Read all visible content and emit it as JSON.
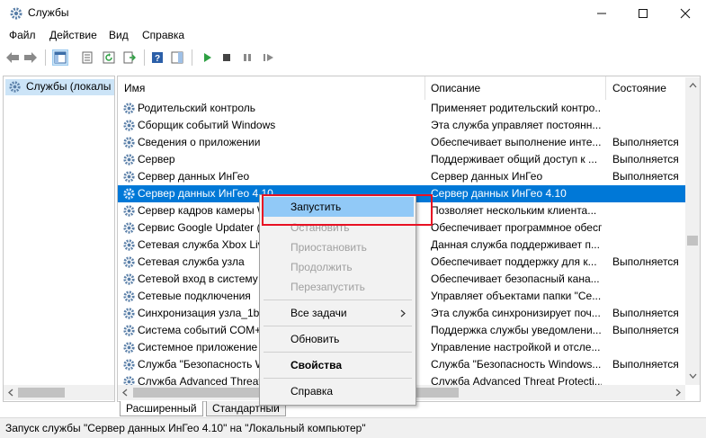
{
  "window": {
    "title": "Службы"
  },
  "menu": [
    "Файл",
    "Действие",
    "Вид",
    "Справка"
  ],
  "tree": {
    "root_label": "Службы (локалы"
  },
  "columns": {
    "name": "Имя",
    "description": "Описание",
    "status": "Состояние"
  },
  "rows": [
    {
      "name": "Родительский контроль",
      "desc": "Применяет родительский контро...",
      "status": ""
    },
    {
      "name": "Сборщик событий Windows",
      "desc": "Эта служба управляет постоянн...",
      "status": ""
    },
    {
      "name": "Сведения о приложении",
      "desc": "Обеспечивает выполнение инте...",
      "status": "Выполняется"
    },
    {
      "name": "Сервер",
      "desc": "Поддерживает общий доступ к ...",
      "status": "Выполняется"
    },
    {
      "name": "Сервер данных ИнГео",
      "desc": "Сервер данных ИнГео",
      "status": "Выполняется"
    },
    {
      "name": "Сервер данных ИнГео 4.10",
      "desc": "Сервер данных ИнГео 4.10",
      "status": ""
    },
    {
      "name": "Сервер кадров камеры W",
      "desc": "Позволяет нескольким клиента...",
      "status": ""
    },
    {
      "name": "Сервис Google Updater (",
      "desc": "Обеспечивает программное обесп...",
      "status": ""
    },
    {
      "name": "Сетевая служба Xbox Liv",
      "desc": "Данная служба поддерживает п...",
      "status": ""
    },
    {
      "name": "Сетевая служба узла",
      "desc": "Обеспечивает поддержку для к...",
      "status": "Выполняется"
    },
    {
      "name": "Сетевой вход в систему",
      "desc": "Обеспечивает безопасный кана...",
      "status": ""
    },
    {
      "name": "Сетевые подключения",
      "desc": "Управляет объектами папки \"Се...",
      "status": ""
    },
    {
      "name": "Синхронизация узла_1b4",
      "desc": "Эта служба синхронизирует поч...",
      "status": "Выполняется"
    },
    {
      "name": "Система событий COM+",
      "desc": "Поддержка службы уведомлени...",
      "status": "Выполняется"
    },
    {
      "name": "Системное приложение",
      "desc": "Управление настройкой и отсле...",
      "status": ""
    },
    {
      "name": "Служба \"Безопасность W",
      "desc": "Служба \"Безопасность Windows...",
      "status": "Выполняется"
    },
    {
      "name": "Служба Advanced Threat",
      "desc": "Служба Advanced Threat Protecti...",
      "status": ""
    }
  ],
  "context_menu": {
    "start": "Запустить",
    "stop": "Остановить",
    "pause": "Приостановить",
    "resume": "Продолжить",
    "restart": "Перезапустить",
    "all_tasks": "Все задачи",
    "refresh": "Обновить",
    "properties": "Свойства",
    "help": "Справка"
  },
  "tabs": [
    "Расширенный",
    "Стандартный"
  ],
  "status_bar": "Запуск службы \"Сервер данных ИнГео 4.10\" на \"Локальный компьютер\"",
  "colors": {
    "selection": "#0078d7",
    "menu_highlight": "#91c9f7",
    "callout": "#e81123",
    "run": "#2ea043"
  }
}
